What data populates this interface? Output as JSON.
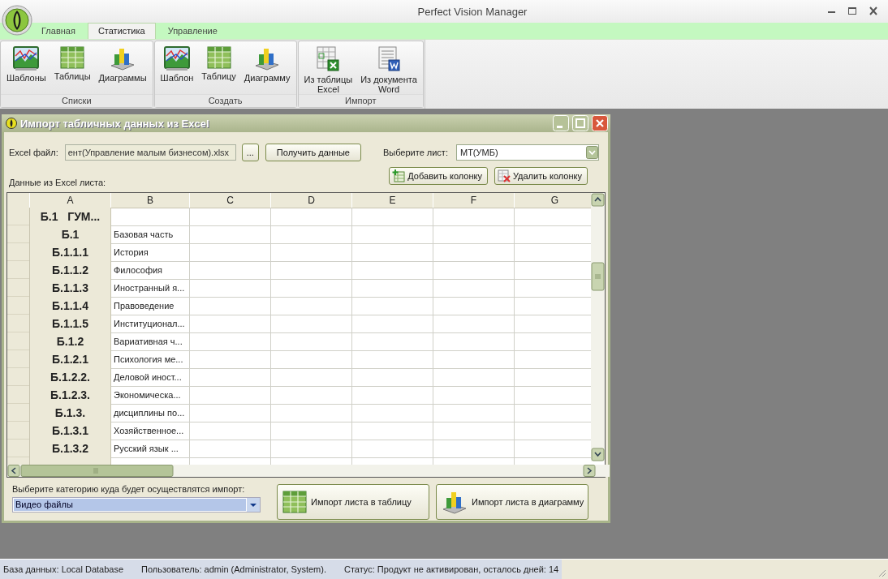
{
  "window": {
    "title": "Perfect Vision Manager"
  },
  "tabs": [
    {
      "label": "Главная",
      "selected": false
    },
    {
      "label": "Статистика",
      "selected": true
    },
    {
      "label": "Управление",
      "selected": false
    }
  ],
  "ribbon_groups": [
    {
      "title": "Списки",
      "buttons": [
        {
          "label": "Шаблоны",
          "kind": "line-chart"
        },
        {
          "label": "Таблицы",
          "kind": "table"
        },
        {
          "label": "Диаграммы",
          "kind": "bar-chart"
        }
      ]
    },
    {
      "title": "Создать",
      "buttons": [
        {
          "label": "Шаблон",
          "kind": "line-chart"
        },
        {
          "label": "Таблицу",
          "kind": "table"
        },
        {
          "label": "Диаграмму",
          "kind": "bar-chart"
        }
      ]
    },
    {
      "title": "Импорт",
      "buttons": [
        {
          "label": "Из таблицы\nExcel",
          "kind": "excel"
        },
        {
          "label": "Из документа\nWord",
          "kind": "word"
        }
      ]
    }
  ],
  "import_dialog": {
    "title": "Импорт табличных данных из Excel",
    "file_label": "Excel файл:",
    "file_value": "ент(Управление малым бизнесом).xlsx",
    "browse_button": "...",
    "get_data_button": "Получить данные",
    "sheet_label": "Выберите лист:",
    "sheet_value": "МТ(УМБ)",
    "data_label": "Данные из Excel листа:",
    "add_column_button": "Добавить колонку",
    "remove_column_button": "Удалить колонку",
    "grid": {
      "columns": [
        "A",
        "B",
        "C",
        "D",
        "E",
        "F",
        "G"
      ],
      "rows": [
        {
          "a": "Б.1   ГУМ..."
        },
        {
          "a": "Б.1",
          "b": "Базовая часть"
        },
        {
          "a": "Б.1.1.1",
          "b": "История"
        },
        {
          "a": "Б.1.1.2",
          "b": "Философия"
        },
        {
          "a": "Б.1.1.3",
          "b": "Иностранный я..."
        },
        {
          "a": "Б.1.1.4",
          "b": "Правоведение"
        },
        {
          "a": "Б.1.1.5",
          "b": "Институционал..."
        },
        {
          "a": "Б.1.2",
          "b": "Вариативная ч..."
        },
        {
          "a": "Б.1.2.1",
          "b": "Психология ме..."
        },
        {
          "a": "Б.1.2.2.",
          "b": "Деловой иност..."
        },
        {
          "a": "Б.1.2.3.",
          "b": "Экономическа..."
        },
        {
          "a": "Б.1.3.",
          "b": "дисциплины по..."
        },
        {
          "a": "Б.1.3.1",
          "b": "Хозяйственное..."
        },
        {
          "a": "Б.1.3.2",
          "b": "Русский язык ..."
        }
      ]
    },
    "category_label": "Выберите категорию куда будет осуществлятся импорт:",
    "category_value": "Видео файлы",
    "import_table_button": "Импорт листа в таблицу",
    "import_chart_button": "Импорт листа в диаграмму"
  },
  "status_bar": {
    "items": [
      "База данных: Local Database",
      "Пользователь: admin (Administrator, System).",
      "Статус: Продукт не активирован, осталось дней: 14"
    ]
  }
}
